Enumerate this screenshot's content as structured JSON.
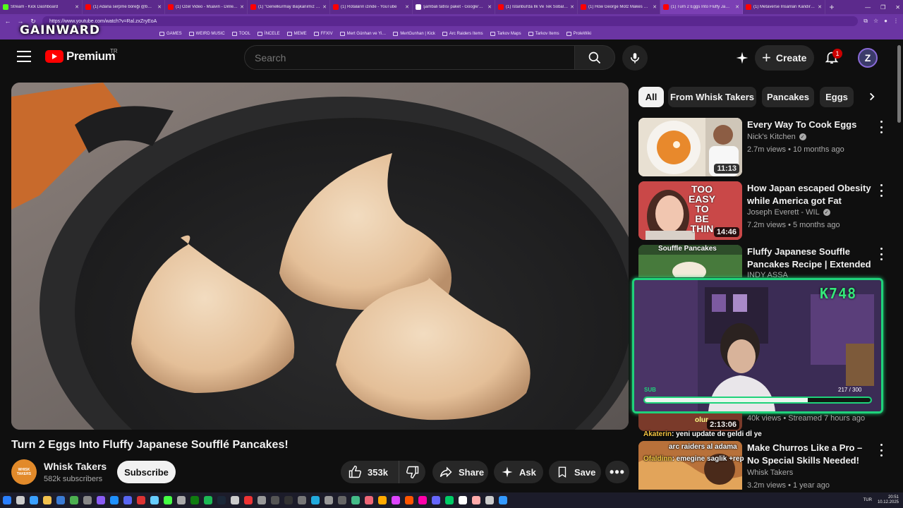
{
  "browser": {
    "tabs": [
      {
        "title": "Stream - Kick Dashboard",
        "color": "#53fc18"
      },
      {
        "title": "(1) Adana serpme böreği @b…",
        "color": "#ff0000"
      },
      {
        "title": "(1) Özel Video - Muavin - Dinlen…",
        "color": "#ff0000"
      },
      {
        "title": "(1) \"Genelkurmay Başkanımız sı…",
        "color": "#ff0000"
      },
      {
        "title": "(1) Rotaların izinde - YouTube",
        "color": "#ff0000"
      },
      {
        "title": "şambali tatlısı paket - Google'da…",
        "color": "#ffffff"
      },
      {
        "title": "(1) İstanbul'da İlk Ve Tek Sobalı …",
        "color": "#ff0000"
      },
      {
        "title": "(1) How George Motz Makes NY…",
        "color": "#ff0000"
      },
      {
        "title": "(1) Turn 2 Eggs Into Fluffy Ja…",
        "color": "#ff0000",
        "active": true
      },
      {
        "title": "(1) Metaverse İnsanları Kandırdı…",
        "color": "#ff0000"
      }
    ],
    "url": "https://www.youtube.com/watch?v=Ral.zxZryEoA",
    "bookmarks": [
      "GAMES",
      "WEIRD MUSIC",
      "TOOL",
      "İNCELE",
      "MEME",
      "FFXIV",
      "Mert Günhan ve Yi…",
      "MertGunhan | Kick",
      "Arc Raiders Items",
      "Tarkov Maps",
      "Tarkov Items",
      "ProleWiki"
    ],
    "overlay_logo": "GAINWARD"
  },
  "header": {
    "logo_text": "Premium",
    "region": "TR",
    "search_placeholder": "Search",
    "create_label": "Create",
    "notification_count": "1",
    "avatar_letter": "Z"
  },
  "video": {
    "title": "Turn 2 Eggs Into Fluffy Japanese Soufflé Pancakes!",
    "channel": "Whisk Takers",
    "channel_avatar_text": "WHISK TAKERS",
    "subscribers": "582k subscribers",
    "subscribe_label": "Subscribe",
    "likes": "353k",
    "share_label": "Share",
    "ask_label": "Ask",
    "save_label": "Save"
  },
  "chips": [
    "All",
    "From Whisk Takers",
    "Pancakes",
    "Eggs"
  ],
  "recommendations": [
    {
      "title": "Every Way To Cook Eggs",
      "channel": "Nick's Kitchen",
      "verified": true,
      "meta": "2.7m views • 10 months ago",
      "duration": "11:13",
      "thumb_text": ""
    },
    {
      "title": "How Japan escaped Obesity while America got Fat",
      "channel": "Joseph Everett - WIL",
      "verified": true,
      "meta": "7.2m views • 5 months ago",
      "duration": "14:46",
      "thumb_text": "TOO EASY TO BE THIN"
    },
    {
      "title": "Fluffy Japanese Souffle Pancakes Recipe | Extended …",
      "channel": "INDY ASSA",
      "verified": false,
      "meta": "",
      "duration": "",
      "thumb_text": "Souffle Pancakes"
    },
    {
      "title": "",
      "channel": "",
      "verified": false,
      "meta": "40k views • Streamed 7 hours ago",
      "duration": "2:13:06",
      "thumb_text": ""
    },
    {
      "title": "Make Churros Like a Pro – No Special Skills Needed!",
      "channel": "Whisk Takers",
      "verified": false,
      "meta": "3.2m views • 1 year ago",
      "duration": "",
      "thumb_text": ""
    }
  ],
  "stream_overlay": {
    "count": "K748",
    "sub_label": "SUB",
    "sub_progress": "217 / 300",
    "sub_fraction": 0.723,
    "chat": [
      {
        "user": "Akaterin",
        "text": ": yeni update de geldi dİ ye"
      },
      {
        "user": "",
        "text": "arc raiders al adama"
      },
      {
        "user": "Ofaldinn",
        "text": ": emegine saglik +rep"
      }
    ],
    "chat_fragment": "olur"
  },
  "taskbar": {
    "lang": "TUR",
    "time": "20:51",
    "date": "10.12.2025"
  }
}
